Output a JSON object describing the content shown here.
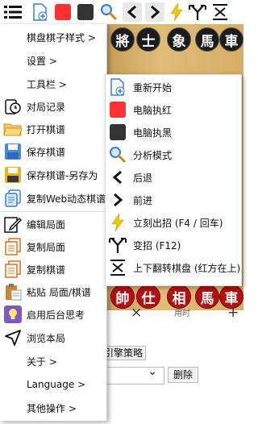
{
  "toolbar": {
    "icons": [
      "menu-icon",
      "new-doc-icon",
      "red-square-icon",
      "black-square-icon",
      "magnifier-icon",
      "back-icon",
      "forward-icon",
      "lightning-icon",
      "branch-icon",
      "flip-icon"
    ]
  },
  "board": {
    "top_pieces": [
      "將",
      "士",
      "象",
      "馬",
      "車"
    ],
    "bottom_pieces": [
      "帥",
      "仕",
      "相",
      "馬",
      "車"
    ]
  },
  "lower": {
    "close_glyph": "×",
    "time_label": "用时",
    "add_glyph": "+",
    "strategy_label": "引擎策略",
    "select_chevron": "⌄",
    "delete_label": "删除"
  },
  "main_menu": {
    "items": [
      {
        "label": "棋盘棋子样式  >",
        "icon": ""
      },
      {
        "label": "设置  >",
        "icon": ""
      },
      {
        "label": "工具栏  >",
        "icon": ""
      },
      {
        "label": "对局记录",
        "icon": "record-clock-icon"
      },
      {
        "label": "打开棋谱",
        "icon": "open-folder-icon"
      },
      {
        "label": "保存棋谱",
        "icon": "save-disk-icon"
      },
      {
        "label": "保存棋谱-另存为",
        "icon": "save-as-disk-icon"
      },
      {
        "label": "复制Web动态棋谱",
        "icon": "copy-web-icon"
      },
      {
        "label": "编辑局面",
        "icon": "edit-icon"
      },
      {
        "label": "复制局面",
        "icon": "copy-position-icon"
      },
      {
        "label": "复制棋谱",
        "icon": "copy-record-icon"
      },
      {
        "label": "粘贴 局面/棋谱",
        "icon": "paste-icon"
      },
      {
        "label": "启用后台思考",
        "icon": "bulb-icon"
      },
      {
        "label": "浏览本局",
        "icon": "navigate-icon"
      },
      {
        "label": "关于  >",
        "icon": ""
      },
      {
        "label": "Language  >",
        "icon": ""
      },
      {
        "label": "其他操作  >",
        "icon": ""
      }
    ]
  },
  "toolbar_submenu": {
    "items": [
      {
        "label": "重新开始",
        "icon": "new-doc-icon"
      },
      {
        "label": "电脑执红",
        "icon": "red-square-icon"
      },
      {
        "label": "电脑执黑",
        "icon": "black-square-icon"
      },
      {
        "label": "分析模式",
        "icon": "magnifier-icon"
      },
      {
        "label": "后退",
        "icon": "back-icon"
      },
      {
        "label": "前进",
        "icon": "forward-icon"
      },
      {
        "label": "立刻出招 (F4 / 回车)",
        "icon": "lightning-icon"
      },
      {
        "label": "变招 (F12)",
        "icon": "branch-icon"
      },
      {
        "label": "上下翻转棋盘 (红方在上)",
        "icon": "flip-icon"
      }
    ]
  },
  "colors": {
    "red": "#ff3030",
    "black": "#333333",
    "lightning": "#f5c400",
    "board": "#e2bd77"
  }
}
